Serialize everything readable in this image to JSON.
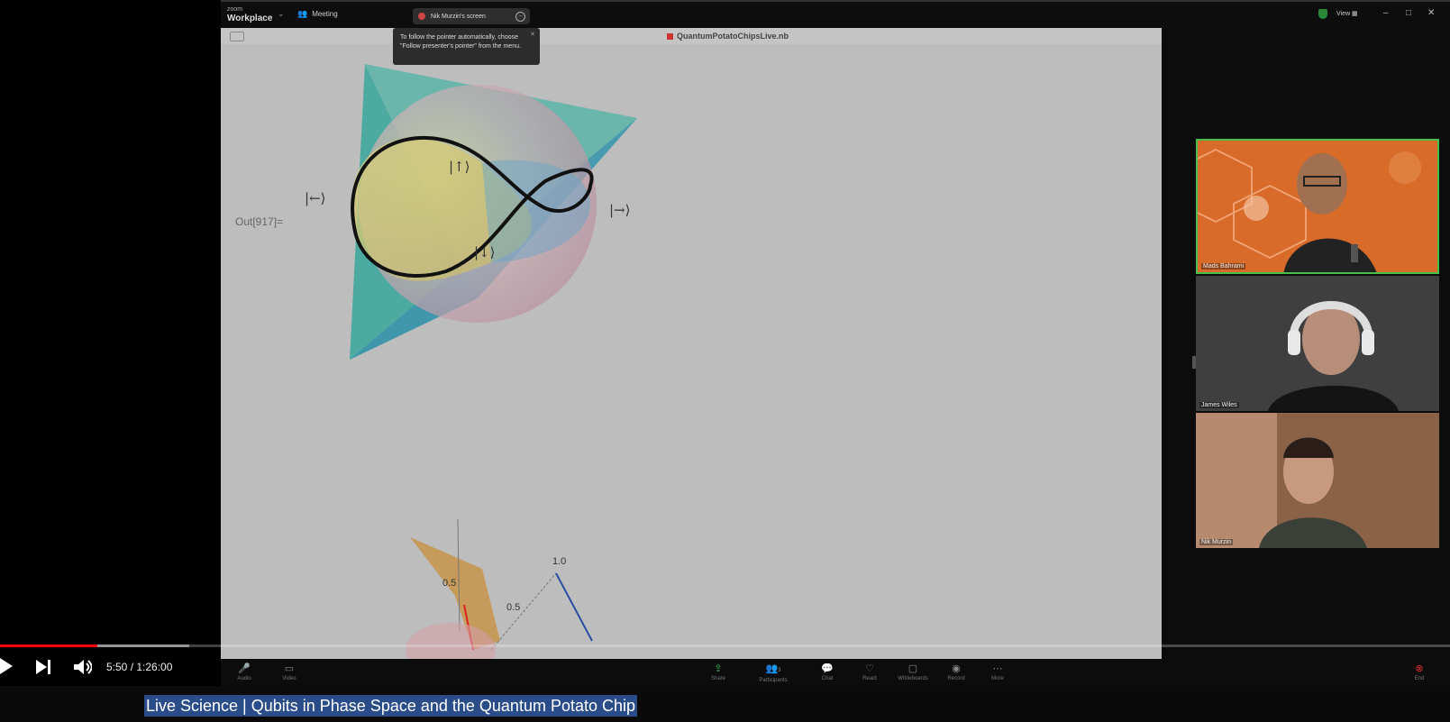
{
  "zoom": {
    "logo_top": "zoom",
    "logo_bottom": "Workplace",
    "meeting_label": "Meeting",
    "screen_share_label": "Nik Murzin's screen",
    "view_label": "View",
    "tooltip_text": "To follow the pointer automatically, choose \"Follow presenter's pointer\" from the menu.",
    "toolbar": [
      {
        "label": "Audio",
        "icon": "mic-icon"
      },
      {
        "label": "Video",
        "icon": "camera-icon"
      },
      {
        "label": "Share",
        "icon": "share-icon"
      },
      {
        "label": "Participants",
        "icon": "participants-icon",
        "count": "3"
      },
      {
        "label": "Chat",
        "icon": "chat-icon"
      },
      {
        "label": "React",
        "icon": "heart-icon"
      },
      {
        "label": "Whiteboards",
        "icon": "whiteboard-icon"
      },
      {
        "label": "Record",
        "icon": "record-icon"
      },
      {
        "label": "More",
        "icon": "more-icon"
      },
      {
        "label": "End",
        "icon": "end-icon"
      }
    ]
  },
  "notebook": {
    "filename": "QuantumPotatoChipsLive.nb",
    "output_label": "Out[917]=",
    "kets": {
      "up": "|↑⟩",
      "down": "|↓⟩",
      "left": "|←⟩",
      "right": "|→⟩"
    },
    "axis_ticks": [
      "1.0",
      "0.5",
      "0.5"
    ]
  },
  "participants": [
    {
      "name": "Mads Bahrami"
    },
    {
      "name": "James Wiles"
    },
    {
      "name": "Nik Murzin"
    }
  ],
  "player": {
    "time": "5:50 / 1:26:00",
    "progress": 0.0674,
    "buffered": 0.1306,
    "video_title": "Live Science | Qubits in Phase Space and the Quantum Potato Chip"
  },
  "colors": {
    "zoom_orange": "#d86a2a",
    "active_speaker_border": "#47c04a",
    "progress_red": "#ff0000",
    "title_highlight": "#2a4d8a"
  }
}
